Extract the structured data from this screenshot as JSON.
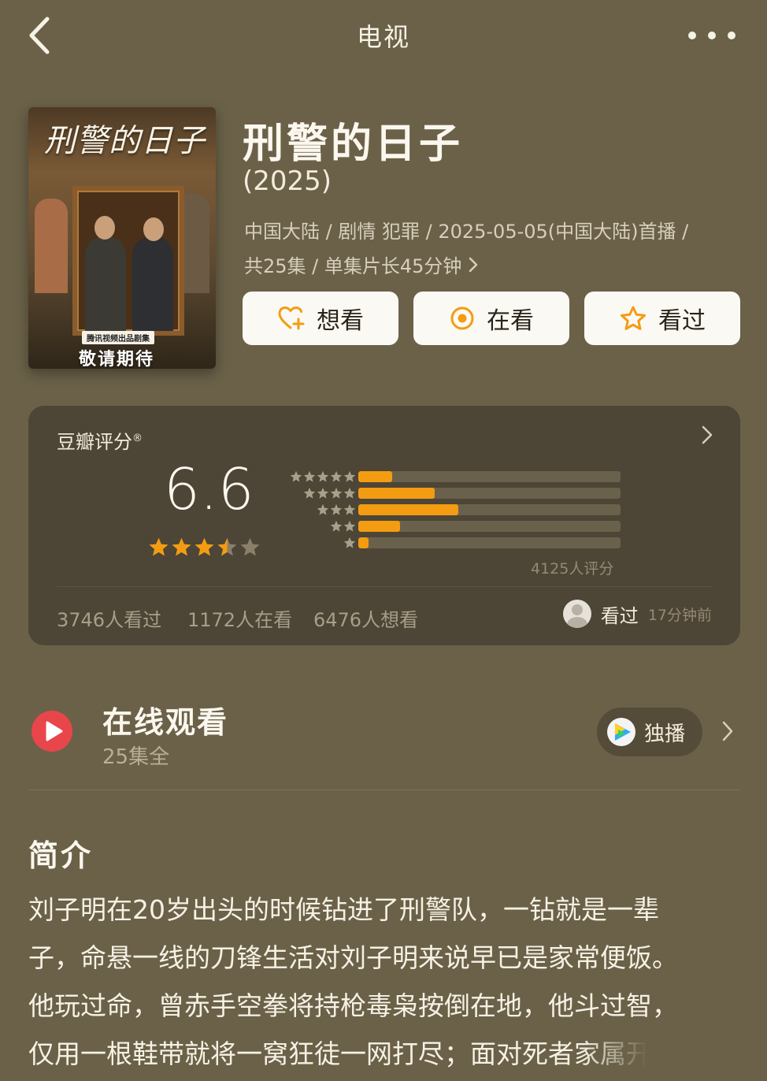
{
  "nav": {
    "title": "电视"
  },
  "show": {
    "poster": {
      "title": "刑警的日子",
      "badge": "腾讯视频出品剧集",
      "tagline": "敬请期待"
    },
    "title": "刑警的日子",
    "year": "(2025)",
    "meta_line1": "中国大陆 / 剧情 犯罪 / 2025-05-05(中国大陆)首播 /",
    "meta_line2": "共25集 / 单集片长45分钟"
  },
  "actions": {
    "want": "想看",
    "watching": "在看",
    "watched": "看过"
  },
  "rating": {
    "label": "豆瓣评分",
    "mark": "®",
    "score": "6.6",
    "stars": 3.5,
    "distribution": [
      {
        "stars": 5,
        "fraction": 0.13
      },
      {
        "stars": 4,
        "fraction": 0.29
      },
      {
        "stars": 3,
        "fraction": 0.38
      },
      {
        "stars": 2,
        "fraction": 0.16
      },
      {
        "stars": 1,
        "fraction": 0.04
      }
    ],
    "count": "4125人评分",
    "watched_count": "3746人看过",
    "watching_count": "1172人在看",
    "want_count": "6476人想看",
    "my_status": "看过",
    "my_status_time": "17分钟前"
  },
  "online": {
    "title": "在线观看",
    "subtitle": "25集全",
    "platform_label": "独播"
  },
  "intro": {
    "heading": "简介",
    "lines": [
      "刘子明在20岁出头的时候钻进了刑警队，一钻就是一辈",
      "子，命悬一线的刀锋生活对刘子明来说早已是家常便饭。",
      "他玩过命，曾赤手空拳将持枪毒枭按倒在地，他斗过智，",
      "仅用一根鞋带就将一窝狂徒一网打尽；面对死者家属开"
    ]
  },
  "colors": {
    "background": "#6a6148",
    "card": "#4d4535",
    "accent": "#f39c12",
    "play_red": "#e8464a"
  },
  "icons": [
    "chevron-left-icon",
    "more-icon",
    "heart-plus-icon",
    "target-icon",
    "star-outline-icon",
    "chevron-right-icon",
    "play-icon",
    "tencent-video-icon"
  ]
}
